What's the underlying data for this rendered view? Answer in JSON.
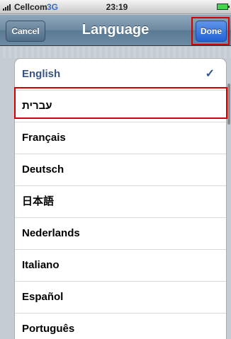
{
  "status_bar": {
    "carrier": "Cellcom",
    "network": "3G",
    "time": "23:19"
  },
  "nav": {
    "title": "Language",
    "cancel_label": "Cancel",
    "done_label": "Done"
  },
  "languages": [
    {
      "label": "English",
      "selected": true
    },
    {
      "label": "עברית",
      "selected": false
    },
    {
      "label": "Français",
      "selected": false
    },
    {
      "label": "Deutsch",
      "selected": false
    },
    {
      "label": "日本語",
      "selected": false
    },
    {
      "label": "Nederlands",
      "selected": false
    },
    {
      "label": "Italiano",
      "selected": false
    },
    {
      "label": "Español",
      "selected": false
    },
    {
      "label": "Português",
      "selected": false
    }
  ],
  "check_glyph": "✓",
  "colors": {
    "highlight": "#d40000",
    "selected_text": "#385487",
    "done_button": "#2562d6"
  }
}
